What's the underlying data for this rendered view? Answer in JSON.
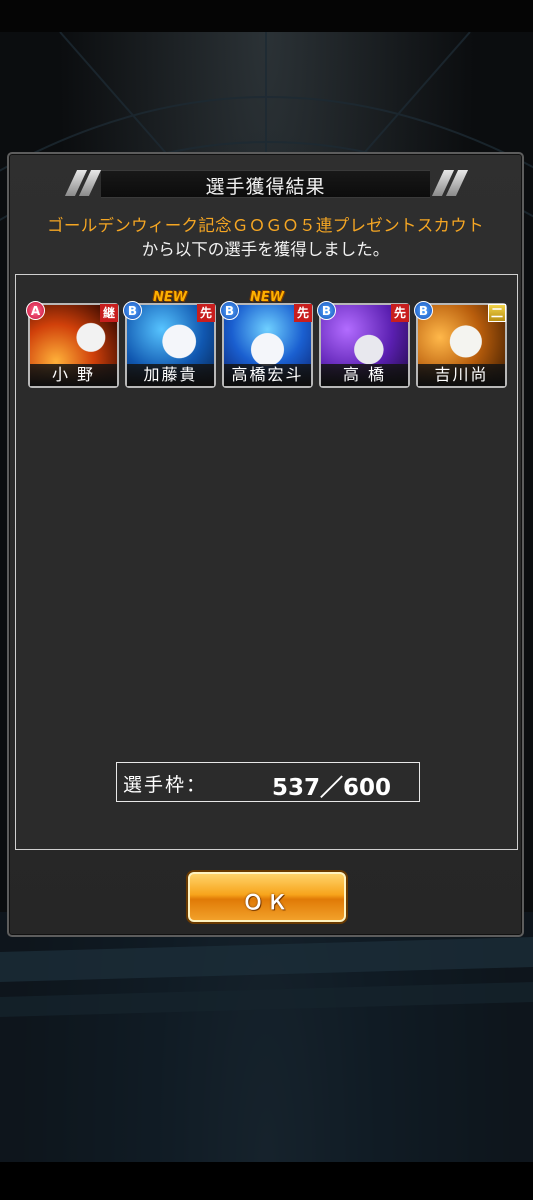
{
  "dialog": {
    "title": "選手獲得結果",
    "message_line1": "ゴールデンウィーク記念ＧＯＧＯ５連プレゼントスカウト",
    "message_line2": "から以下の選手を獲得しました。",
    "ok_label": "ＯＫ",
    "slots_label": "選手枠：",
    "slots_value": "537／600"
  },
  "cards": [
    {
      "name": "小 野",
      "rank": "A",
      "tag": "継",
      "new": "",
      "theme": "fire"
    },
    {
      "name": "加藤貴",
      "rank": "B",
      "tag": "先",
      "new": "NEW",
      "theme": "blue"
    },
    {
      "name": "高橋宏斗",
      "rank": "B",
      "tag": "先",
      "new": "NEW",
      "theme": "blue"
    },
    {
      "name": "高 橋",
      "rank": "B",
      "tag": "先",
      "new": "",
      "theme": "purple"
    },
    {
      "name": "吉川尚",
      "rank": "B",
      "tag": "二",
      "new": "",
      "theme": "gold"
    }
  ],
  "colors": {
    "accent_orange": "#f5a623",
    "rank_a": "#c8143e",
    "rank_b": "#1752b8",
    "tag_red": "#c81e1e"
  }
}
